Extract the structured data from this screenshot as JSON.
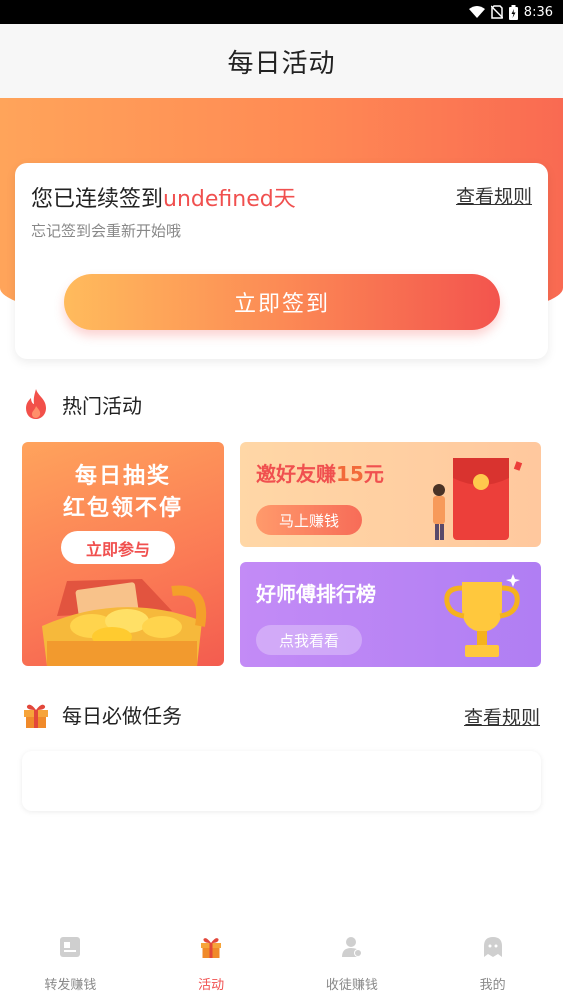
{
  "status_bar": {
    "time": "8:36"
  },
  "header": {
    "title": "每日活动"
  },
  "sign_in": {
    "title_prefix": "您已连续签到",
    "days_value": "undefined",
    "title_suffix": "天",
    "rules_link": "查看规则",
    "subtitle": "忘记签到会重新开始哦",
    "button": "立即签到"
  },
  "hot_section": {
    "title": "热门活动"
  },
  "promos": {
    "lottery": {
      "line1": "每日抽奖",
      "line2": "红包领不停",
      "button": "立即参与"
    },
    "invite": {
      "title_prefix": "邀好友赚",
      "amount": "15",
      "title_suffix": "元",
      "button": "马上赚钱"
    },
    "ranking": {
      "title": "好师傅排行榜",
      "button": "点我看看"
    }
  },
  "task_section": {
    "title": "每日必做任务",
    "rules_link": "查看规则"
  },
  "tabs": [
    {
      "label": "转发赚钱",
      "icon": "article-icon",
      "active": false
    },
    {
      "label": "活动",
      "icon": "gift-icon",
      "active": true
    },
    {
      "label": "收徒赚钱",
      "icon": "user-add-icon",
      "active": false
    },
    {
      "label": "我的",
      "icon": "ghost-icon",
      "active": false
    }
  ],
  "colors": {
    "accent": "#f0504f",
    "orange": "#ff8a54",
    "purple": "#b07ef3"
  }
}
